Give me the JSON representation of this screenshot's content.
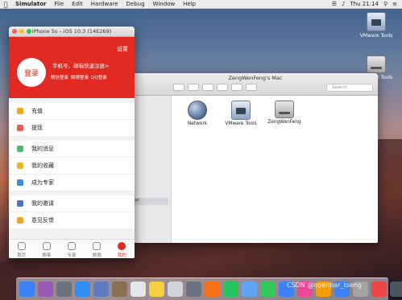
{
  "menubar": {
    "items": [
      "Simulator",
      "File",
      "Edit",
      "Hardware",
      "Debug",
      "Window",
      "Help"
    ],
    "clock": "Thu 21:14"
  },
  "desktop_icons": [
    {
      "label": "VMware Tools"
    },
    {
      "label": "VMware Tools"
    }
  ],
  "simulator": {
    "title": "iPhone 5s – iOS 10.3 (14E269)",
    "app": {
      "settings": "设置",
      "login": "登录",
      "register_prompt": "手机号、邮箱快速注册>",
      "social": [
        "微信登录",
        "微博登录",
        "QQ登录"
      ],
      "menu_groups": [
        [
          {
            "label": "充值",
            "color": "#f5a623"
          },
          {
            "label": "提现",
            "color": "#e95a5a"
          }
        ],
        [
          {
            "label": "我的消息",
            "color": "#4cb86b"
          },
          {
            "label": "我的收藏",
            "color": "#f0b429"
          },
          {
            "label": "成为专家",
            "color": "#3d8fe0"
          }
        ],
        [
          {
            "label": "我的邀请",
            "color": "#4c72c9"
          },
          {
            "label": "意见反馈",
            "color": "#f5a623"
          }
        ]
      ],
      "tabs": [
        "首页",
        "赛事",
        "专家",
        "数据",
        "我的"
      ],
      "active_tab": "我的"
    }
  },
  "finder": {
    "title": "ZengWenFeng's Mac",
    "search_placeholder": "Search",
    "sidebar_item": "ac",
    "items": [
      "Network",
      "VMware Tools",
      "ZengWenFeng"
    ]
  },
  "dock": {
    "icon_colors": [
      "#3b82f6",
      "#9b59b6",
      "#6b7280",
      "#2f8ef0",
      "#5c7cbf",
      "#8b6f4e",
      "#e5e7eb",
      "#f4d03f",
      "#d1d5db",
      "#6b7280",
      "#f97316",
      "#22c55e",
      "#60a5fa",
      "#34c759",
      "#3b82f6",
      "#ec4899",
      "#f59e0b",
      "#3b82f6",
      "#a3a3a3",
      "#ef4444",
      "#4b5563"
    ]
  },
  "watermark": "CSDN @openbar_tseng"
}
